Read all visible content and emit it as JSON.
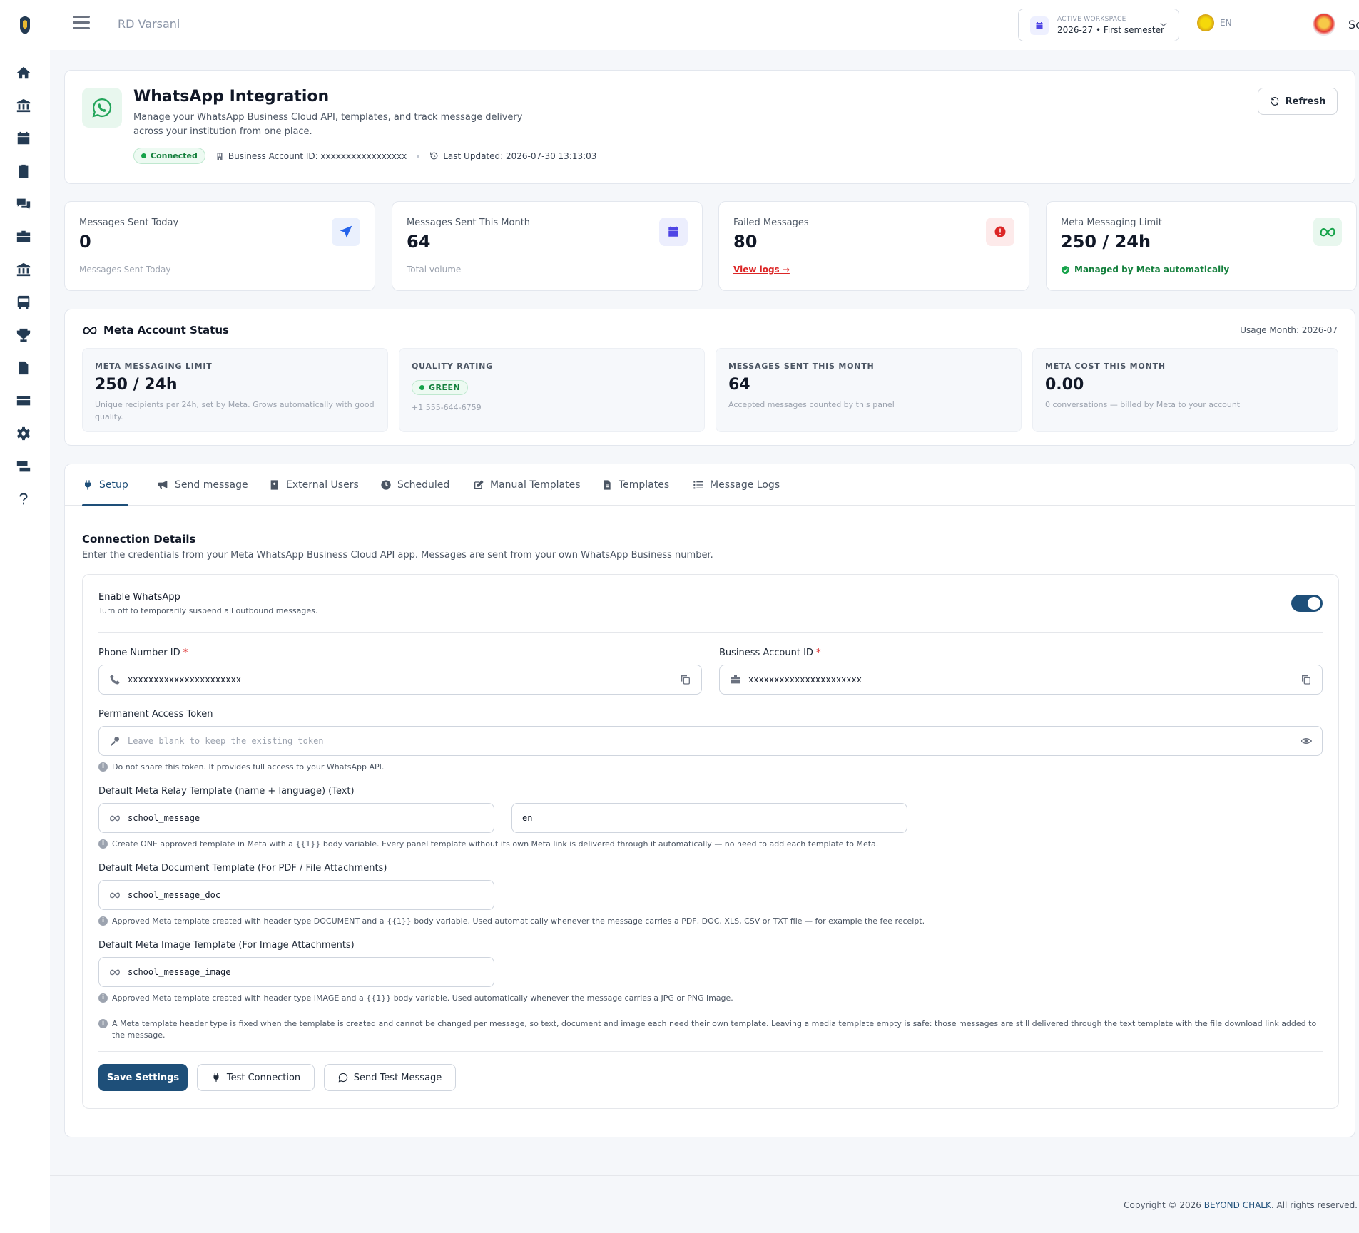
{
  "topbar": {
    "school_name": "RD Varsani",
    "workspace_label": "ACTIVE WORKSPACE",
    "workspace_value": "2026-27 • First semester",
    "language": "EN",
    "user_name": "School"
  },
  "header": {
    "title": "WhatsApp Integration",
    "subtitle": "Manage your WhatsApp Business Cloud API, templates, and track message delivery across your institution from one place.",
    "status": "Connected",
    "business_account": "Business Account ID: xxxxxxxxxxxxxxxxx",
    "last_updated": "Last Updated: 2026-07-30 13:13:03",
    "refresh_label": "Refresh"
  },
  "stats": [
    {
      "label": "Messages Sent Today",
      "value": "0",
      "foot": "Messages Sent Today",
      "icon": "paper-plane-icon",
      "color": "#2563eb"
    },
    {
      "label": "Messages Sent This Month",
      "value": "64",
      "foot": "Total volume",
      "icon": "calendar-icon",
      "color": "#4f46e5"
    },
    {
      "label": "Failed Messages",
      "value": "80",
      "foot": "View logs →",
      "icon": "alert-icon",
      "color": "#dc2626"
    },
    {
      "label": "Meta Messaging Limit",
      "value": "250 / 24h",
      "foot": "Managed by Meta automatically",
      "icon": "meta-icon",
      "color": "#16a34a"
    }
  ],
  "account": {
    "title": "Meta Account Status",
    "usage_month": "Usage Month: 2026-07",
    "boxes": [
      {
        "label": "META MESSAGING LIMIT",
        "value": "250 / 24h",
        "note": "Unique recipients per 24h, set by Meta. Grows automatically with good quality."
      },
      {
        "label": "QUALITY RATING",
        "value": "GREEN",
        "note": "+1 555-644-6759"
      },
      {
        "label": "MESSAGES SENT THIS MONTH",
        "value": "64",
        "note": "Accepted messages counted by this panel"
      },
      {
        "label": "META COST THIS MONTH",
        "value": "0.00",
        "note": "0 conversations — billed by Meta to your account"
      }
    ]
  },
  "tabs": [
    "Setup",
    "Send message",
    "External Users",
    "Scheduled",
    "Manual Templates",
    "Templates",
    "Message Logs"
  ],
  "setup": {
    "title": "Connection Details",
    "subtitle": "Enter the credentials from your Meta WhatsApp Business Cloud API app. Messages are sent from your own WhatsApp Business number.",
    "enable_title": "Enable WhatsApp",
    "enable_sub": "Turn off to temporarily suspend all outbound messages.",
    "phone_label": "Phone Number ID",
    "phone_value": "xxxxxxxxxxxxxxxxxxxxxx",
    "business_label": "Business Account ID",
    "business_value": "xxxxxxxxxxxxxxxxxxxxxx",
    "token_label": "Permanent Access Token",
    "token_placeholder": "Leave blank to keep the existing token",
    "token_hint": "Do not share this token. It provides full access to your WhatsApp API.",
    "relay_label": "Default Meta Relay Template (name + language) (Text)",
    "relay_name": "school_message",
    "relay_lang": "en",
    "relay_hint": "Create ONE approved template in Meta with a {{1}} body variable. Every panel template without its own Meta link is delivered through it automatically — no need to add each template to Meta.",
    "doc_label": "Default Meta Document Template (For PDF / File Attachments)",
    "doc_value": "school_message_doc",
    "doc_hint": "Approved Meta template created with header type DOCUMENT and a {{1}} body variable. Used automatically whenever the message carries a PDF, DOC, XLS, CSV or TXT file — for example the fee receipt.",
    "img_label": "Default Meta Image Template (For Image Attachments)",
    "img_value": "school_message_image",
    "img_hint": "Approved Meta template created with header type IMAGE and a {{1}} body variable. Used automatically whenever the message carries a JPG or PNG image.",
    "media_hint": "A Meta template header type is fixed when the template is created and cannot be changed per message, so text, document and image each need their own template. Leaving a media template empty is safe: those messages are still delivered through the text template with the file download link added to the message.",
    "save_label": "Save Settings",
    "test_conn_label": "Test Connection",
    "test_msg_label": "Send Test Message"
  },
  "footer": {
    "prefix": "Copyright © 2026 ",
    "brand": "BEYOND CHALK",
    "suffix": ". All rights reserved."
  }
}
